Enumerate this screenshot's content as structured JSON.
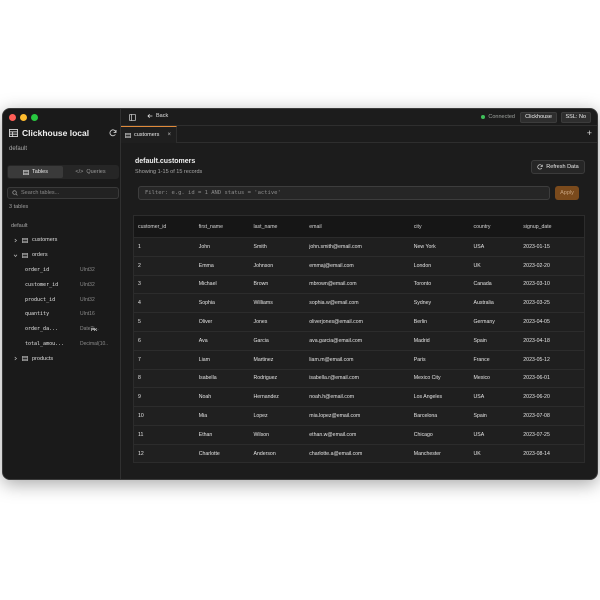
{
  "app": {
    "title": "Clickhouse local",
    "subtitle": "default",
    "traffic_colors": [
      "#ff5f57",
      "#febc2e",
      "#28c840"
    ]
  },
  "sidebar": {
    "tabs": [
      {
        "label": "Tables",
        "icon": "table-icon",
        "active": true
      },
      {
        "label": "Queries",
        "icon": "code-icon",
        "active": false
      }
    ],
    "search_placeholder": "Search tables...",
    "table_count": "3 tables",
    "schema": "default",
    "tables": [
      {
        "name": "customers",
        "expanded": false
      },
      {
        "name": "orders",
        "expanded": true,
        "columns": [
          {
            "name": "order_id",
            "type": "UInt32",
            "pk": ""
          },
          {
            "name": "customer_id",
            "type": "UInt32",
            "pk": ""
          },
          {
            "name": "product_id",
            "type": "UInt32",
            "pk": ""
          },
          {
            "name": "quantity",
            "type": "UInt16",
            "pk": ""
          },
          {
            "name": "order_da...",
            "type": "DateTi...",
            "pk": "PK"
          },
          {
            "name": "total_amou...",
            "type": "Decimal(10...",
            "pk": ""
          }
        ]
      },
      {
        "name": "products",
        "expanded": false
      }
    ]
  },
  "topbar": {
    "back_label": "Back",
    "status": "Connected",
    "host": "Clickhouse",
    "ssl": "SSL: No",
    "accent": "#e08a3a"
  },
  "tab": {
    "label": "customers",
    "close": "×",
    "new_tab": "+"
  },
  "content": {
    "title": "default.customers",
    "subtitle": "Showing 1-15 of 15 records",
    "refresh_label": "Refresh Data",
    "filter_placeholder": "Filter: e.g. id = 1 AND status = 'active'",
    "apply_label": "Apply"
  },
  "grid": {
    "columns": [
      "customer_id",
      "first_name",
      "last_name",
      "email",
      "city",
      "country",
      "signup_date"
    ],
    "rows": [
      [
        "1",
        "John",
        "Smith",
        "john.smith@email.com",
        "New York",
        "USA",
        "2023-01-15"
      ],
      [
        "2",
        "Emma",
        "Johnson",
        "emmaj@email.com",
        "London",
        "UK",
        "2023-02-20"
      ],
      [
        "3",
        "Michael",
        "Brown",
        "mbrown@email.com",
        "Toronto",
        "Canada",
        "2023-03-10"
      ],
      [
        "4",
        "Sophia",
        "Williams",
        "sophia.w@email.com",
        "Sydney",
        "Australia",
        "2023-03-25"
      ],
      [
        "5",
        "Oliver",
        "Jones",
        "oliverjones@email.com",
        "Berlin",
        "Germany",
        "2023-04-05"
      ],
      [
        "6",
        "Ava",
        "Garcia",
        "ava.garcia@email.com",
        "Madrid",
        "Spain",
        "2023-04-18"
      ],
      [
        "7",
        "Liam",
        "Martinez",
        "liam.m@email.com",
        "Paris",
        "France",
        "2023-05-12"
      ],
      [
        "8",
        "Isabella",
        "Rodriguez",
        "isabella.r@email.com",
        "Mexico City",
        "Mexico",
        "2023-06-01"
      ],
      [
        "9",
        "Noah",
        "Hernandez",
        "noah.h@email.com",
        "Los Angeles",
        "USA",
        "2023-06-20"
      ],
      [
        "10",
        "Mia",
        "Lopez",
        "mia.lopez@email.com",
        "Barcelona",
        "Spain",
        "2023-07-08"
      ],
      [
        "11",
        "Ethan",
        "Wilson",
        "ethan.w@email.com",
        "Chicago",
        "USA",
        "2023-07-25"
      ],
      [
        "12",
        "Charlotte",
        "Anderson",
        "charlotte.a@email.com",
        "Manchester",
        "UK",
        "2023-08-14"
      ]
    ]
  }
}
